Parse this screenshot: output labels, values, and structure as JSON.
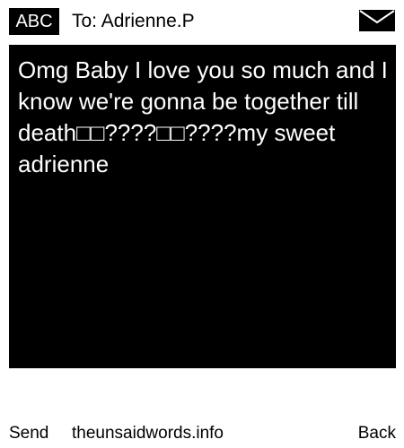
{
  "header": {
    "mode_badge": "ABC",
    "to_line": "To: Adrienne.P",
    "envelope_icon": "envelope-icon"
  },
  "message": {
    "text": "Omg Baby I love you so much and I know we're gonna be together till death□□????□□????my sweet adrienne"
  },
  "footer": {
    "send_label": "Send",
    "site_label": "theunsaidwords.info",
    "back_label": "Back"
  },
  "colors": {
    "background": "#ffffff",
    "message_background": "#000000",
    "message_text": "#ffffff",
    "badge_background": "#000000"
  }
}
